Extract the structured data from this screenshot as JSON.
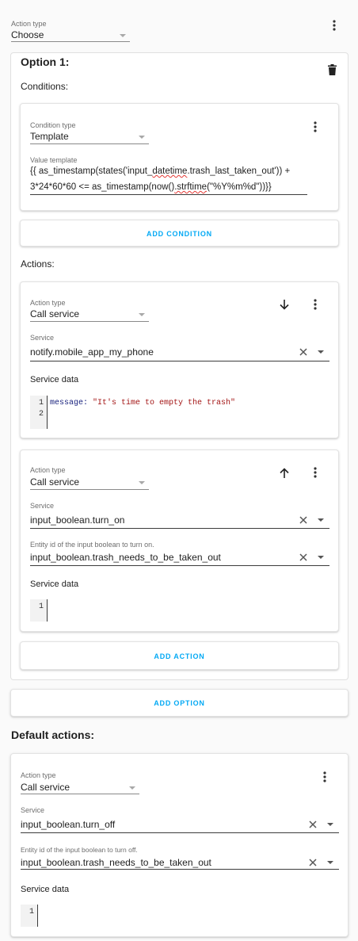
{
  "top": {
    "action_type_label": "Action type",
    "action_type_value": "Choose"
  },
  "option1": {
    "title": "Option 1:",
    "conditions_heading": "Conditions:",
    "condition": {
      "type_label": "Condition type",
      "type_value": "Template",
      "value_template_label": "Value template",
      "template_line1_a": "{{ as_timestamp(states('input_",
      "template_line1_b": "datetime",
      "template_line1_c": ".trash_last_taken_out')) +",
      "template_line2_a": "3*24*60*60 <= as_timestamp(now()",
      "template_line2_b": ".strftime",
      "template_line2_c": "(\"%Y%m%d\"))}}"
    },
    "add_condition_label": "ADD CONDITION",
    "actions_heading": "Actions:",
    "action1": {
      "type_label": "Action type",
      "type_value": "Call service",
      "service_label": "Service",
      "service_value": "notify.mobile_app_my_phone",
      "service_data_heading": "Service data",
      "code_line_numbers": [
        "1",
        "2"
      ],
      "code_key": "message:",
      "code_string": "\"It's time to empty the trash\""
    },
    "action2": {
      "type_label": "Action type",
      "type_value": "Call service",
      "service_label": "Service",
      "service_value": "input_boolean.turn_on",
      "entity_label": "Entity id of the input boolean to turn on.",
      "entity_value": "input_boolean.trash_needs_to_be_taken_out",
      "service_data_heading": "Service data",
      "code_line_numbers": [
        "1"
      ]
    },
    "add_action_label": "ADD ACTION"
  },
  "add_option_label": "ADD OPTION",
  "default_actions": {
    "heading": "Default actions:",
    "type_label": "Action type",
    "type_value": "Call service",
    "service_label": "Service",
    "service_value": "input_boolean.turn_off",
    "entity_label": "Entity id of the input boolean to turn off.",
    "entity_value": "input_boolean.trash_needs_to_be_taken_out",
    "service_data_heading": "Service data",
    "code_line_numbers": [
      "1"
    ]
  },
  "colors": {
    "accent": "#03a9f4",
    "code_key": "#1a237e",
    "code_string": "#a31515",
    "squiggle": "#e53935"
  },
  "icons": [
    "more-vert-icon",
    "delete-icon",
    "arrow-down-icon",
    "arrow-up-icon",
    "clear-icon",
    "dropdown-arrow-icon"
  ]
}
